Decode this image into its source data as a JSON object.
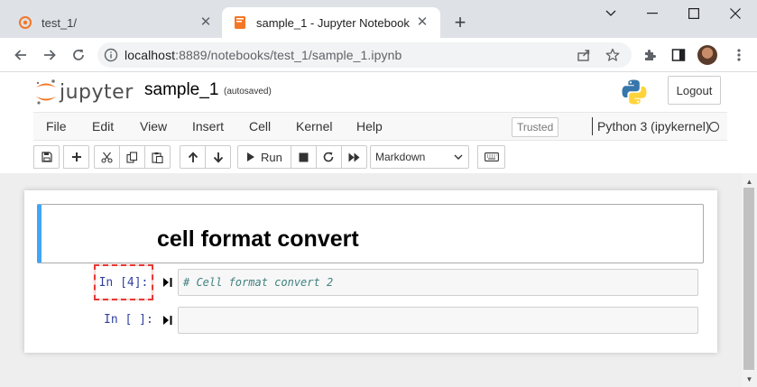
{
  "browser": {
    "tabs": [
      {
        "title": "test_1/",
        "active": false
      },
      {
        "title": "sample_1 - Jupyter Notebook",
        "active": true
      }
    ],
    "url": {
      "host": "localhost",
      "rest": ":8889/notebooks/test_1/sample_1.ipynb"
    }
  },
  "jupyter": {
    "logo_text": "jupyter",
    "notebook_name": "sample_1",
    "save_status": "(autosaved)",
    "logout_label": "Logout",
    "menu": [
      "File",
      "Edit",
      "View",
      "Insert",
      "Cell",
      "Kernel",
      "Help"
    ],
    "trusted_label": "Trusted",
    "kernel_name": "Python 3 (ipykernel)",
    "toolbar": {
      "run_label": "Run",
      "cell_type": "Markdown"
    }
  },
  "cells": [
    {
      "type": "markdown",
      "heading": "cell format convert"
    },
    {
      "type": "code",
      "prompt": "In [4]:",
      "source": "# Cell format convert 2",
      "highlighted": true
    },
    {
      "type": "code",
      "prompt": "In [ ]:",
      "source": ""
    }
  ],
  "colors": {
    "selected_cell_bar": "#42a5f5",
    "prompt": "#303f9f",
    "comment": "#408080",
    "highlight": "#e53935"
  }
}
